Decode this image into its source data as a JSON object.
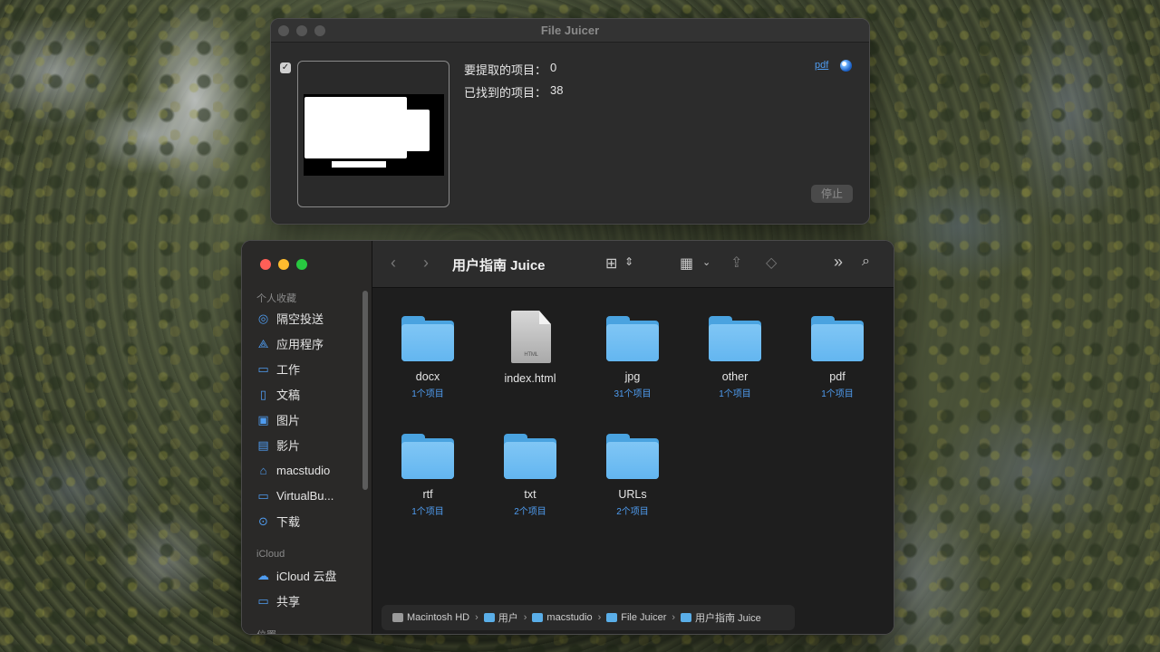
{
  "file_juicer": {
    "title": "File Juicer",
    "extract_label": "要提取的项目：",
    "extract_value": "0",
    "found_label": "已找到的项目：",
    "found_value": "38",
    "type_link": "pdf",
    "checkbox_checked": true,
    "stop_button": "停止"
  },
  "finder": {
    "title": "用户指南 Juice",
    "sidebar": {
      "favorites_header": "个人收藏",
      "favorites": [
        {
          "label": "隔空投送",
          "icon": "airdrop-icon"
        },
        {
          "label": "应用程序",
          "icon": "applications-icon"
        },
        {
          "label": "工作",
          "icon": "folder-icon"
        },
        {
          "label": "文稿",
          "icon": "document-icon"
        },
        {
          "label": "图片",
          "icon": "photo-icon"
        },
        {
          "label": "影片",
          "icon": "film-icon"
        },
        {
          "label": "macstudio",
          "icon": "home-icon"
        },
        {
          "label": "VirtualBu...",
          "icon": "folder-icon"
        },
        {
          "label": "下载",
          "icon": "download-icon"
        }
      ],
      "icloud_header": "iCloud",
      "icloud": [
        {
          "label": "iCloud 云盘",
          "icon": "cloud-icon"
        },
        {
          "label": "共享",
          "icon": "shared-folder-icon"
        }
      ],
      "locations_header": "位置"
    },
    "items": [
      {
        "name": "docx",
        "count": "1个项目",
        "kind": "folder"
      },
      {
        "name": "index.html",
        "count": "",
        "kind": "html-file"
      },
      {
        "name": "jpg",
        "count": "31个项目",
        "kind": "folder"
      },
      {
        "name": "other",
        "count": "1个项目",
        "kind": "folder"
      },
      {
        "name": "pdf",
        "count": "1个项目",
        "kind": "folder"
      },
      {
        "name": "rtf",
        "count": "1个项目",
        "kind": "folder"
      },
      {
        "name": "txt",
        "count": "2个项目",
        "kind": "folder"
      },
      {
        "name": "URLs",
        "count": "2个项目",
        "kind": "folder"
      }
    ],
    "html_file_tag": "HTML",
    "path": [
      "Macintosh HD",
      "用户",
      "macstudio",
      "File Juicer",
      "用户指南 Juice"
    ],
    "colors": {
      "accent": "#4f9cf0",
      "folder": "#63b6f0"
    }
  }
}
